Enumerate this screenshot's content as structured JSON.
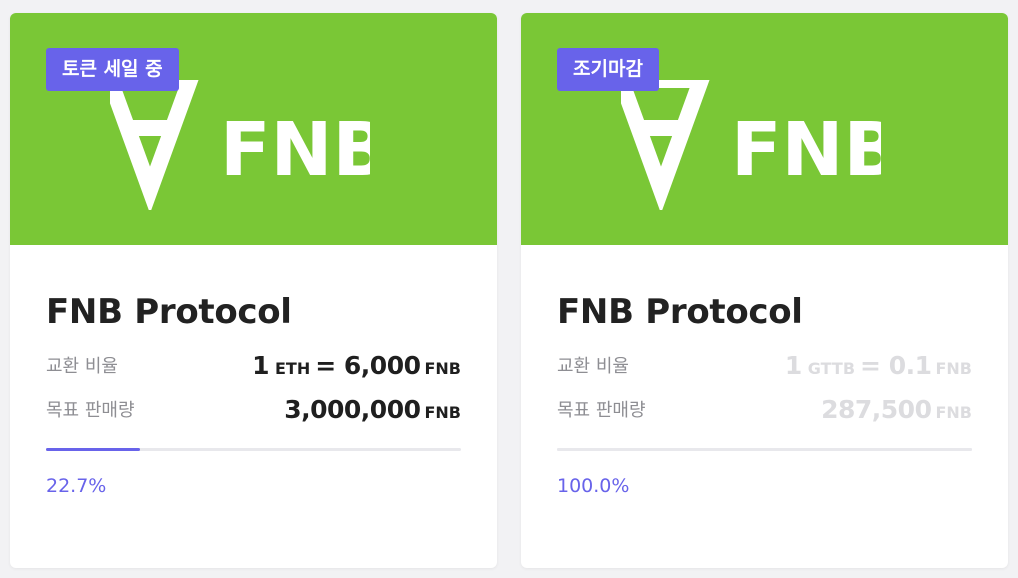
{
  "colors": {
    "banner": "#7ac736",
    "accent": "#6863ea",
    "muted_value": "#dcdcdf"
  },
  "cards": [
    {
      "badge": "토큰 세일 중",
      "logo_icon": "fnb-logo",
      "logo_text": "FNB",
      "title": "FNB Protocol",
      "rate_label": "교환 비율",
      "rate_amount": "1",
      "rate_from_unit": "ETH",
      "rate_equals": "=",
      "rate_value": "6,000",
      "rate_to_unit": "FNB",
      "target_label": "목표 판매량",
      "target_value": "3,000,000",
      "target_unit": "FNB",
      "progress": 0.227,
      "percent": "22.7%"
    },
    {
      "badge": "조기마감",
      "logo_icon": "fnb-logo",
      "logo_text": "FNB",
      "title": "FNB Protocol",
      "rate_label": "교환 비율",
      "rate_amount": "1",
      "rate_from_unit": "GTTB",
      "rate_equals": "=",
      "rate_value": "0.1",
      "rate_to_unit": "FNB",
      "target_label": "목표 판매량",
      "target_value": "287,500",
      "target_unit": "FNB",
      "progress": 1.0,
      "percent": "100.0%"
    }
  ]
}
